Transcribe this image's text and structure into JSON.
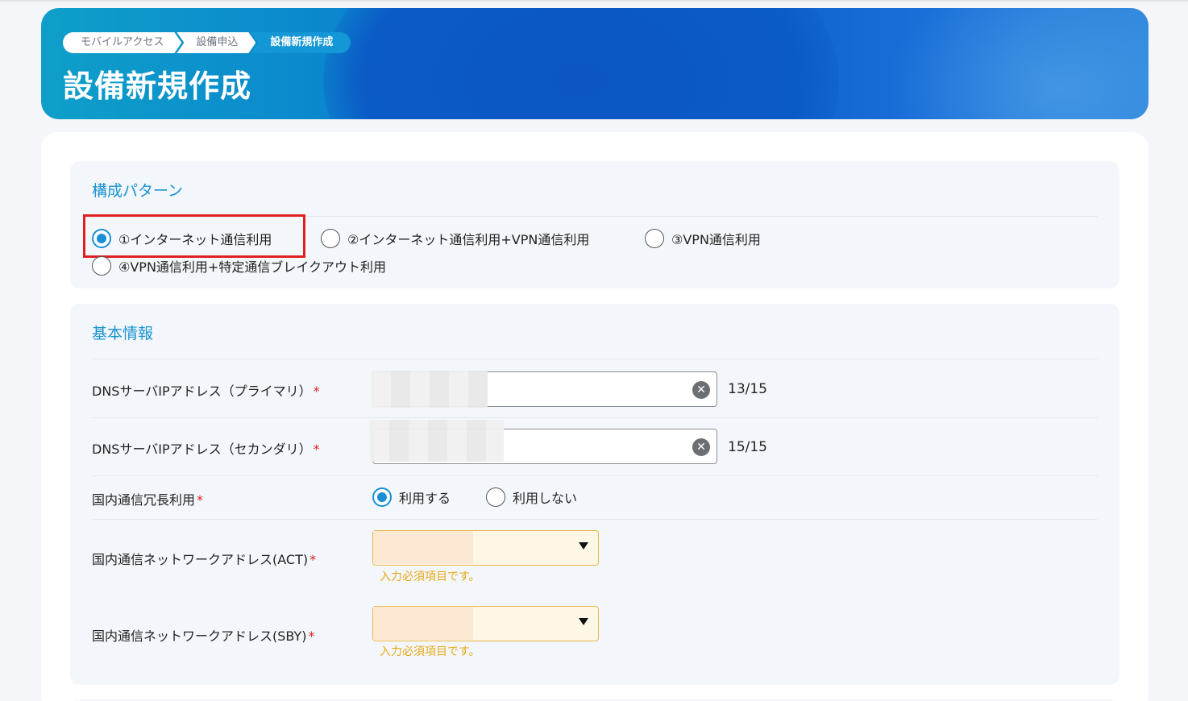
{
  "breadcrumb": [
    "モバイルアクセス",
    "設備申込",
    "設備新規作成"
  ],
  "page_title": "設備新規作成",
  "pattern_section": {
    "title": "構成パターン",
    "options": [
      {
        "label": "①インターネット通信利用",
        "selected": true
      },
      {
        "label": "②インターネット通信利用+VPN通信利用",
        "selected": false
      },
      {
        "label": "③VPN通信利用",
        "selected": false
      },
      {
        "label": "④VPN通信利用+特定通信ブレイクアウト利用",
        "selected": false
      }
    ]
  },
  "basic_section": {
    "title": "基本情報",
    "required_mark": "*",
    "dns_primary": {
      "label": "DNSサーバIPアドレス（プライマリ）",
      "counter": "13/15"
    },
    "dns_secondary": {
      "label": "DNSサーバIPアドレス（セカンダリ）",
      "counter": "15/15"
    },
    "redundancy": {
      "label": "国内通信冗長利用",
      "options": [
        {
          "label": "利用する",
          "selected": true
        },
        {
          "label": "利用しない",
          "selected": false
        }
      ]
    },
    "act": {
      "label": "国内通信ネットワークアドレス(ACT)",
      "error": "入力必須項目です。"
    },
    "sby": {
      "label": "国内通信ネットワークアドレス(SBY)",
      "error": "入力必須項目です。"
    }
  },
  "colors": {
    "accent": "#1a93d1",
    "required": "#e02020",
    "warning": "#e8a817"
  }
}
